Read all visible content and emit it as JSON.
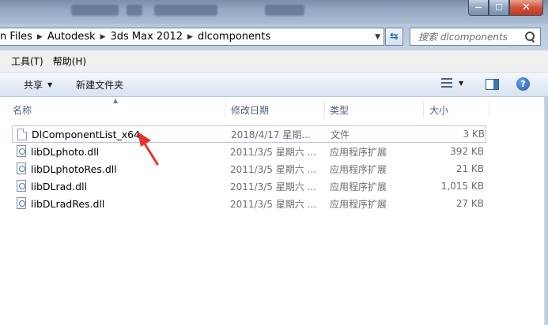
{
  "window": {
    "controls": {
      "minimize": "—",
      "maximize": "☐",
      "close": "✕"
    }
  },
  "address": {
    "crumbs": [
      "n Files",
      "Autodesk",
      "3ds Max 2012",
      "dlcomponents"
    ],
    "refresh_icon": "refresh-arrows-icon"
  },
  "search": {
    "placeholder": "搜索 dlcomponents"
  },
  "menu": {
    "tools": "工具(T)",
    "help": "帮助(H)"
  },
  "toolbar": {
    "share": "共享",
    "new_folder": "新建文件夹"
  },
  "columns": {
    "name": "名称",
    "date": "修改日期",
    "type": "类型",
    "size": "大小"
  },
  "files": [
    {
      "name": "DlComponentList_x64",
      "date": "2018/4/17 星期...",
      "type": "文件",
      "size": "3 KB",
      "icon": "generic-file-icon",
      "selected": true
    },
    {
      "name": "libDLphoto.dll",
      "date": "2011/3/5 星期六 ...",
      "type": "应用程序扩展",
      "size": "392 KB",
      "icon": "dll-file-icon"
    },
    {
      "name": "libDLphotoRes.dll",
      "date": "2011/3/5 星期六 ...",
      "type": "应用程序扩展",
      "size": "21 KB",
      "icon": "dll-file-icon"
    },
    {
      "name": "libDLrad.dll",
      "date": "2011/3/5 星期六 ...",
      "type": "应用程序扩展",
      "size": "1,015 KB",
      "icon": "dll-file-icon"
    },
    {
      "name": "libDLradRes.dll",
      "date": "2011/3/5 星期六 ...",
      "type": "应用程序扩展",
      "size": "27 KB",
      "icon": "dll-file-icon"
    }
  ],
  "annotation": {
    "color": "#e8332a",
    "icon": "red-arrow-annotation"
  }
}
